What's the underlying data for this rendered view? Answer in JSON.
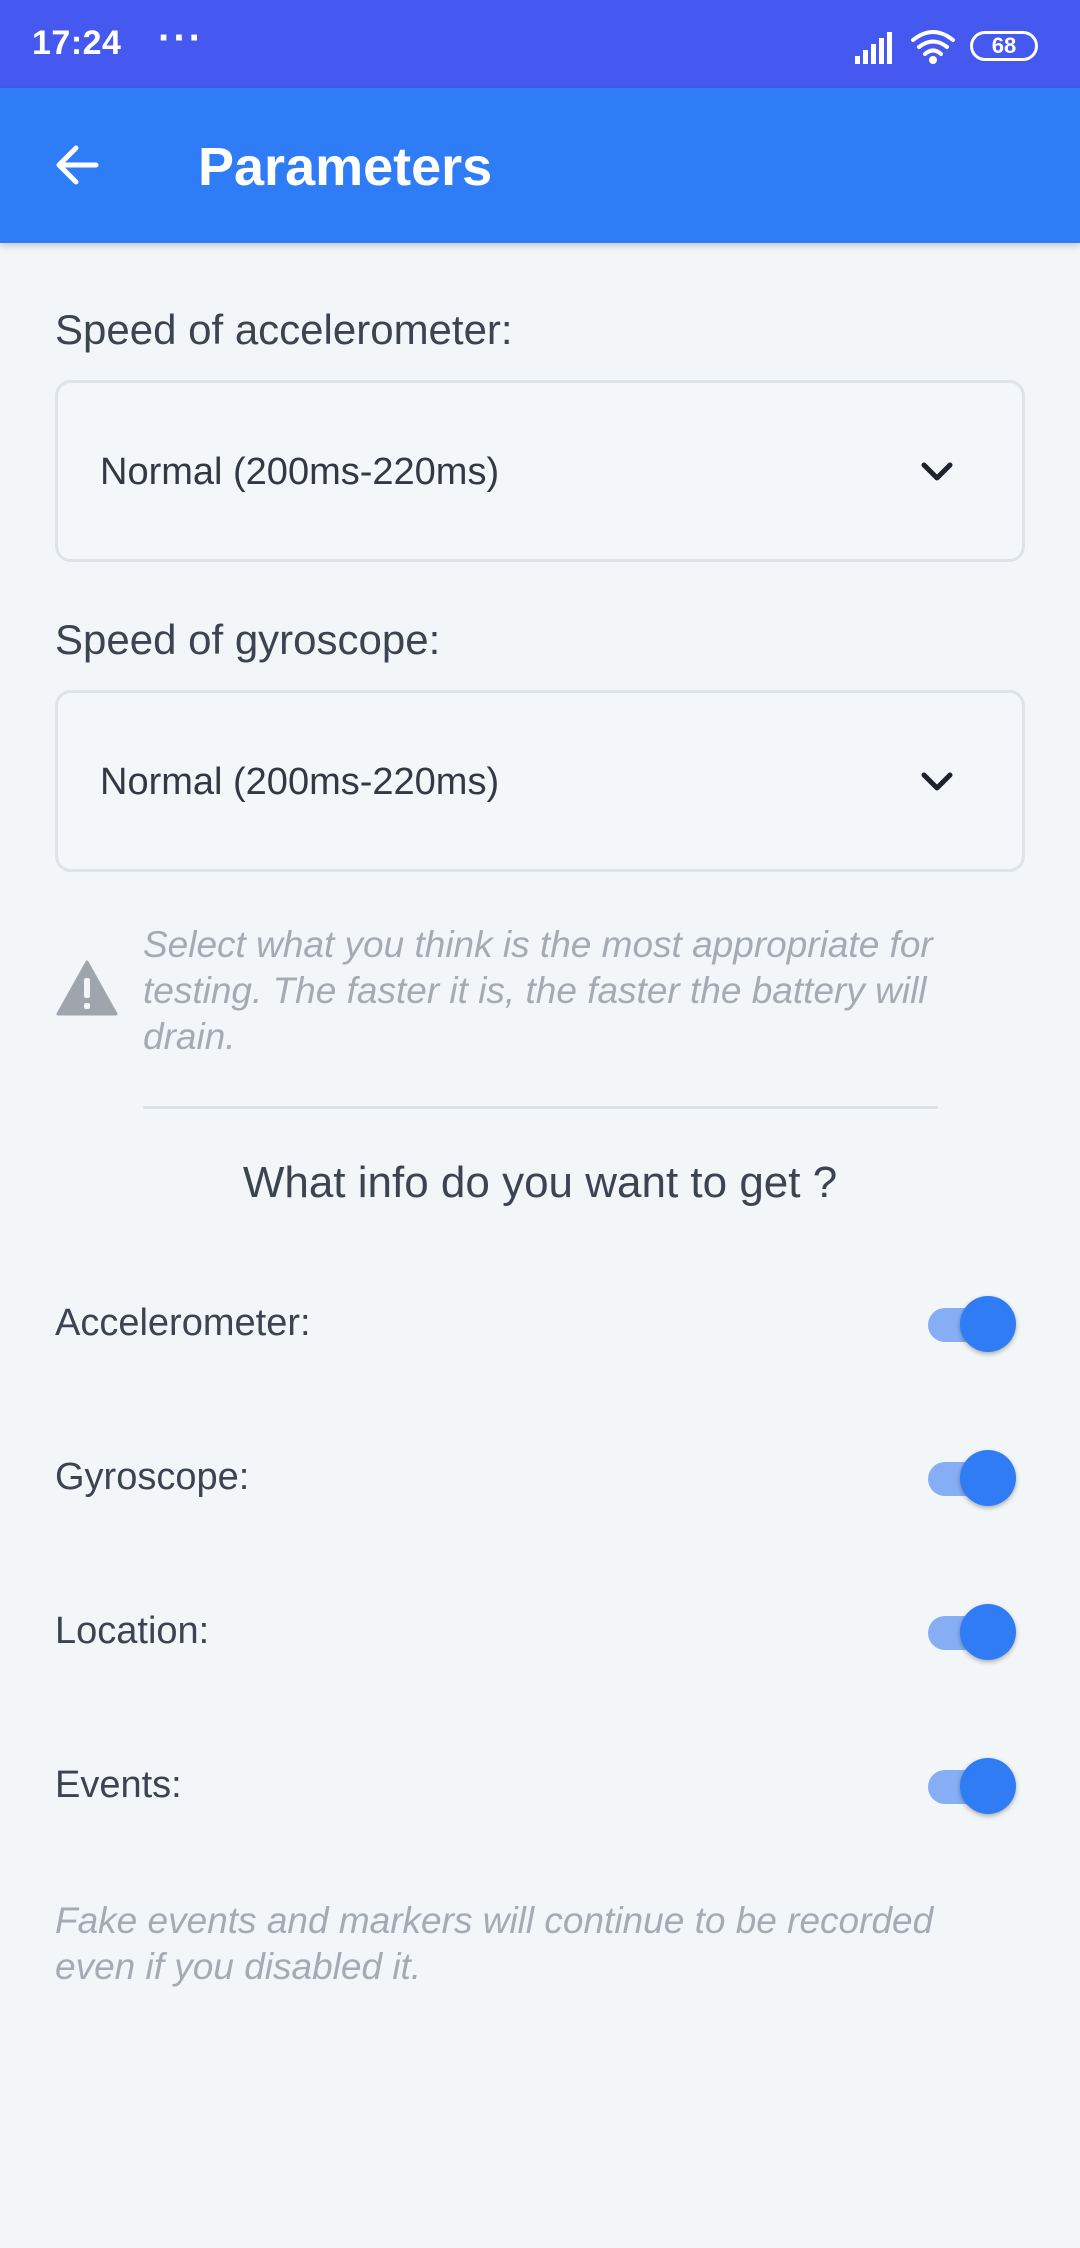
{
  "status_bar": {
    "time": "17:24",
    "more": "···",
    "battery": "68",
    "icons": [
      "signal-icon",
      "wifi-icon",
      "battery-icon"
    ]
  },
  "app_bar": {
    "title": "Parameters",
    "back_icon": "arrow-left-icon",
    "color": "#2e7cf6"
  },
  "accelerometer_speed": {
    "label": "Speed of accelerometer:",
    "selected": "Normal (200ms-220ms)"
  },
  "gyroscope_speed": {
    "label": "Speed of gyroscope:",
    "selected": "Normal (200ms-220ms)"
  },
  "warning": {
    "icon": "warning-icon",
    "text": "Select what you think is the most appropriate for testing. The faster it is, the faster the battery will drain."
  },
  "info_section": {
    "title": "What info do you want to get ?",
    "toggles": [
      {
        "label": "Accelerometer:",
        "on": true
      },
      {
        "label": "Gyroscope:",
        "on": true
      },
      {
        "label": "Location:",
        "on": true
      },
      {
        "label": "Events:",
        "on": true
      }
    ]
  },
  "footnote": "Fake events and markers will continue to be recorded even if you disabled it.",
  "colors": {
    "status_bar": "#4558f0",
    "accent": "#2f7cf4",
    "background": "#f2f6f9"
  }
}
